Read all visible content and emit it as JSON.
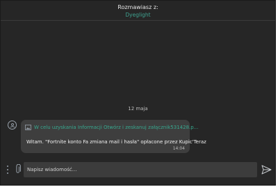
{
  "header": {
    "label": "Rozmawiasz z:",
    "contact_name": "Dyeglight"
  },
  "conversation": {
    "date_separator": "12 maja",
    "messages": [
      {
        "attachment_text": "W celu uzyskania Informacji Otwórz i zeskanuj załącznik531428.p...",
        "body": "Witam. \"Fortnite konto Fa zmiana mail i hasła\" opłacone przez Kupic'Teraz",
        "time": "14:04"
      }
    ]
  },
  "composer": {
    "placeholder": "Napisz wiadomość..."
  },
  "icons": {
    "avatar": "user-avatar-icon",
    "attachment": "image-file-icon",
    "more": "vertical-dots-icon",
    "attach": "paperclip-icon",
    "send": "send-icon"
  },
  "colors": {
    "background": "#262626",
    "bubble": "#3e3e3e",
    "accent": "#37a88f",
    "input": "#3c3c3c"
  }
}
